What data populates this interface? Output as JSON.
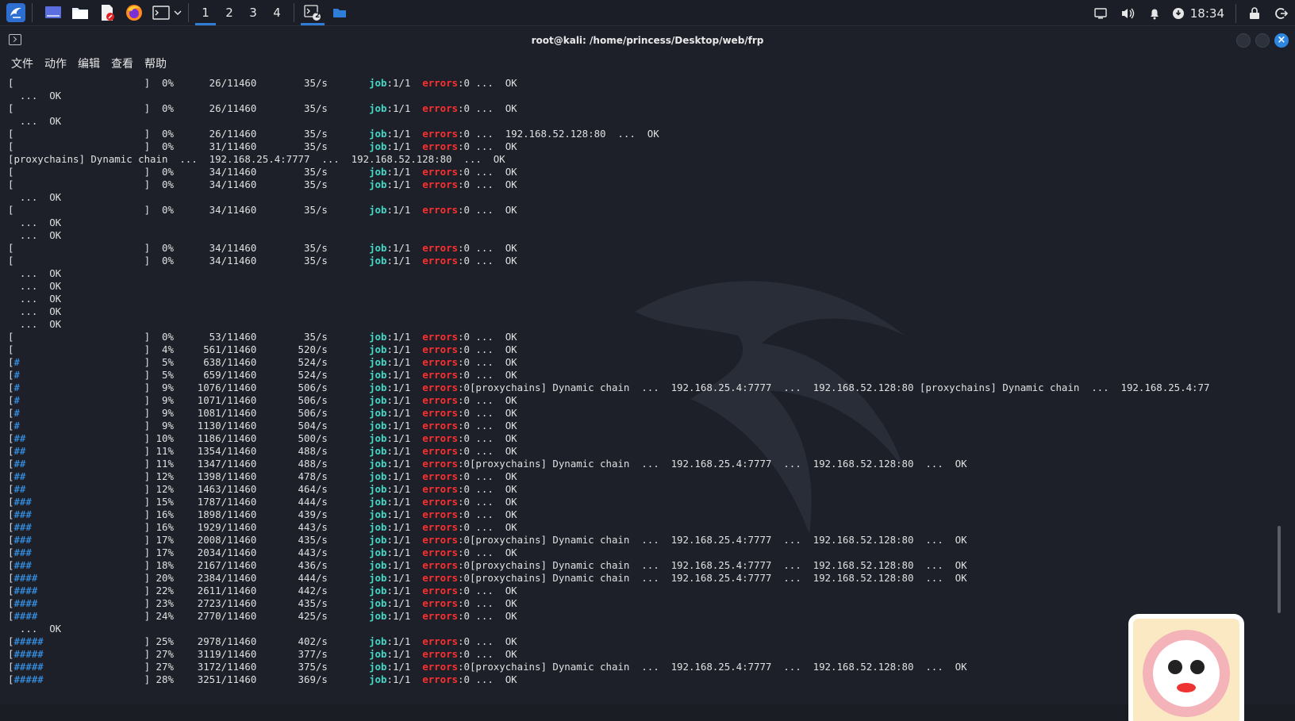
{
  "panel": {
    "workspaces": [
      "1",
      "2",
      "3",
      "4"
    ],
    "active_workspace": "1",
    "terminal_badge": "2",
    "clock": "18:34"
  },
  "window": {
    "title": "root@kali: /home/princess/Desktop/web/frp"
  },
  "menu": [
    "文件",
    "动作",
    "编辑",
    "查看",
    "帮助"
  ],
  "term_lines": [
    {
      "t": "progress",
      "bar": "",
      "pct": "0%",
      "cnt": "26/11460",
      "rate": "35/s",
      "tail": " ...  OK"
    },
    {
      "t": "ok"
    },
    {
      "t": "progress",
      "bar": "",
      "pct": "0%",
      "cnt": "26/11460",
      "rate": "35/s",
      "tail": " ...  OK"
    },
    {
      "t": "ok"
    },
    {
      "t": "progress",
      "bar": "",
      "pct": "0%",
      "cnt": "26/11460",
      "rate": "35/s",
      "tail": " ...  192.168.52.128:80  ...  OK"
    },
    {
      "t": "progress",
      "bar": "",
      "pct": "0%",
      "cnt": "31/11460",
      "rate": "35/s",
      "tail": " ...  OK"
    },
    {
      "t": "raw",
      "text": "[proxychains] Dynamic chain  ...  192.168.25.4:7777  ...  192.168.52.128:80  ...  OK"
    },
    {
      "t": "progress",
      "bar": "",
      "pct": "0%",
      "cnt": "34/11460",
      "rate": "35/s",
      "tail": " ...  OK"
    },
    {
      "t": "progress",
      "bar": "",
      "pct": "0%",
      "cnt": "34/11460",
      "rate": "35/s",
      "tail": " ...  OK"
    },
    {
      "t": "ok"
    },
    {
      "t": "progress",
      "bar": "",
      "pct": "0%",
      "cnt": "34/11460",
      "rate": "35/s",
      "tail": " ...  OK"
    },
    {
      "t": "ok"
    },
    {
      "t": "ok"
    },
    {
      "t": "progress",
      "bar": "",
      "pct": "0%",
      "cnt": "34/11460",
      "rate": "35/s",
      "tail": " ...  OK"
    },
    {
      "t": "progress",
      "bar": "",
      "pct": "0%",
      "cnt": "34/11460",
      "rate": "35/s",
      "tail": " ...  OK"
    },
    {
      "t": "ok"
    },
    {
      "t": "ok"
    },
    {
      "t": "ok"
    },
    {
      "t": "ok"
    },
    {
      "t": "ok"
    },
    {
      "t": "progress",
      "bar": "",
      "pct": "0%",
      "cnt": "53/11460",
      "rate": "35/s",
      "tail": " ...  OK"
    },
    {
      "t": "progress",
      "bar": "",
      "pct": "4%",
      "cnt": "561/11460",
      "rate": "520/s",
      "tail": " ...  OK"
    },
    {
      "t": "progress",
      "bar": "#",
      "pct": "5%",
      "cnt": "638/11460",
      "rate": "524/s",
      "tail": " ...  OK"
    },
    {
      "t": "progress",
      "bar": "#",
      "pct": "5%",
      "cnt": "659/11460",
      "rate": "524/s",
      "tail": " ...  OK"
    },
    {
      "t": "progress",
      "bar": "#",
      "pct": "9%",
      "cnt": "1076/11460",
      "rate": "506/s",
      "tail": "[proxychains] Dynamic chain  ...  192.168.25.4:7777  ...  192.168.52.128:80 [proxychains] Dynamic chain  ...  192.168.25.4:77"
    },
    {
      "t": "progress",
      "bar": "#",
      "pct": "9%",
      "cnt": "1071/11460",
      "rate": "506/s",
      "tail": " ...  OK"
    },
    {
      "t": "progress",
      "bar": "#",
      "pct": "9%",
      "cnt": "1081/11460",
      "rate": "506/s",
      "tail": " ...  OK"
    },
    {
      "t": "progress",
      "bar": "#",
      "pct": "9%",
      "cnt": "1130/11460",
      "rate": "504/s",
      "tail": " ...  OK"
    },
    {
      "t": "progress",
      "bar": "##",
      "pct": "10%",
      "cnt": "1186/11460",
      "rate": "500/s",
      "tail": " ...  OK"
    },
    {
      "t": "progress",
      "bar": "##",
      "pct": "11%",
      "cnt": "1354/11460",
      "rate": "488/s",
      "tail": " ...  OK"
    },
    {
      "t": "progress",
      "bar": "##",
      "pct": "11%",
      "cnt": "1347/11460",
      "rate": "488/s",
      "tail": "[proxychains] Dynamic chain  ...  192.168.25.4:7777  ...  192.168.52.128:80  ...  OK"
    },
    {
      "t": "progress",
      "bar": "##",
      "pct": "12%",
      "cnt": "1398/11460",
      "rate": "478/s",
      "tail": " ...  OK"
    },
    {
      "t": "progress",
      "bar": "##",
      "pct": "12%",
      "cnt": "1463/11460",
      "rate": "464/s",
      "tail": " ...  OK"
    },
    {
      "t": "progress",
      "bar": "###",
      "pct": "15%",
      "cnt": "1787/11460",
      "rate": "444/s",
      "tail": " ...  OK"
    },
    {
      "t": "progress",
      "bar": "###",
      "pct": "16%",
      "cnt": "1898/11460",
      "rate": "439/s",
      "tail": " ...  OK"
    },
    {
      "t": "progress",
      "bar": "###",
      "pct": "16%",
      "cnt": "1929/11460",
      "rate": "443/s",
      "tail": " ...  OK"
    },
    {
      "t": "progress",
      "bar": "###",
      "pct": "17%",
      "cnt": "2008/11460",
      "rate": "435/s",
      "tail": "[proxychains] Dynamic chain  ...  192.168.25.4:7777  ...  192.168.52.128:80  ...  OK"
    },
    {
      "t": "progress",
      "bar": "###",
      "pct": "17%",
      "cnt": "2034/11460",
      "rate": "443/s",
      "tail": " ...  OK"
    },
    {
      "t": "progress",
      "bar": "###",
      "pct": "18%",
      "cnt": "2167/11460",
      "rate": "436/s",
      "tail": "[proxychains] Dynamic chain  ...  192.168.25.4:7777  ...  192.168.52.128:80  ...  OK"
    },
    {
      "t": "progress",
      "bar": "####",
      "pct": "20%",
      "cnt": "2384/11460",
      "rate": "444/s",
      "tail": "[proxychains] Dynamic chain  ...  192.168.25.4:7777  ...  192.168.52.128:80  ...  OK"
    },
    {
      "t": "progress",
      "bar": "####",
      "pct": "22%",
      "cnt": "2611/11460",
      "rate": "442/s",
      "tail": " ...  OK"
    },
    {
      "t": "progress",
      "bar": "####",
      "pct": "23%",
      "cnt": "2723/11460",
      "rate": "435/s",
      "tail": " ...  OK"
    },
    {
      "t": "progress",
      "bar": "####",
      "pct": "24%",
      "cnt": "2770/11460",
      "rate": "425/s",
      "tail": " ...  OK"
    },
    {
      "t": "ok"
    },
    {
      "t": "progress",
      "bar": "#####",
      "pct": "25%",
      "cnt": "2978/11460",
      "rate": "402/s",
      "tail": " ...  OK"
    },
    {
      "t": "progress",
      "bar": "#####",
      "pct": "27%",
      "cnt": "3119/11460",
      "rate": "377/s",
      "tail": " ...  OK"
    },
    {
      "t": "progress",
      "bar": "#####",
      "pct": "27%",
      "cnt": "3172/11460",
      "rate": "375/s",
      "tail": "[proxychains] Dynamic chain  ...  192.168.25.4:7777  ...  192.168.52.128:80  ...  OK"
    },
    {
      "t": "progress",
      "bar": "#####",
      "pct": "28%",
      "cnt": "3251/11460",
      "rate": "369/s",
      "tail": " ...  OK"
    }
  ],
  "term_labels": {
    "ok": " ...  OK",
    "job_key": "job",
    "job_val": ":1/1",
    "err_key": "errors",
    "err_val": ":0"
  },
  "icons": {
    "launcher": "kali-dragon-icon",
    "desktop": "show-desktop-icon",
    "files": "file-manager-icon",
    "editor": "text-editor-icon",
    "browser": "firefox-icon",
    "terminal": "terminal-icon",
    "tray": [
      "display-icon",
      "volume-icon",
      "notification-bell-icon",
      "update-icon",
      "lock-icon",
      "logout-icon"
    ]
  },
  "colors": {
    "accent": "#2f7dd6",
    "job": "#43d7c6",
    "errors": "#ff2f2f",
    "bar": "#3aa0ff"
  }
}
